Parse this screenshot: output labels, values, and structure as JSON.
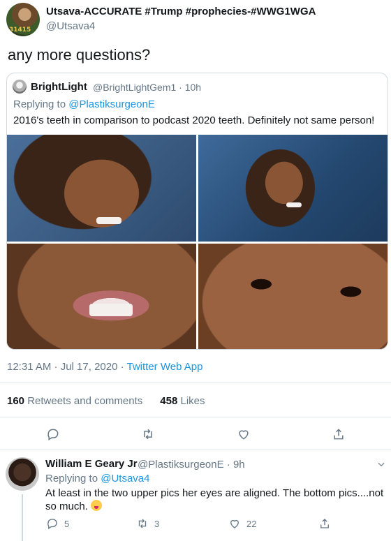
{
  "tweet": {
    "author_name": "Utsava-ACCURATE #Trump #prophecies-#WWG1WGA",
    "author_handle": "@Utsava4",
    "avatar_badge": "31415",
    "text": "any more questions?",
    "timestamp": "12:31 AM · Jul 17, 2020 · ",
    "source_app": "Twitter Web App",
    "retweets_count": "160",
    "retweets_label": " Retweets and comments",
    "likes_count": "458",
    "likes_label": " Likes"
  },
  "quoted_tweet": {
    "author_name": "BrightLight",
    "author_handle": "@BrightLightGem1 · 10h",
    "replying_prefix": "Replying to ",
    "replying_to": "@PlastiksurgeonE",
    "text": "2016's teeth in comparison to podcast 2020 teeth. Definitely not same person!"
  },
  "reply": {
    "author_name": "William E Geary Jr",
    "author_handle": "@PlastiksurgeonE · 9h",
    "replying_prefix": "Replying to ",
    "replying_to": "@Utsava4",
    "text": "At least in the two upper pics her eyes are aligned. The bottom pics....not so much. ",
    "reply_count": "5",
    "retweet_count": "3",
    "like_count": "22"
  },
  "icons": {
    "reply": "reply-icon",
    "retweet": "retweet-icon",
    "like": "heart-icon",
    "share": "share-icon",
    "more": "chevron-down-icon",
    "emoji": "zany-face-emoji"
  },
  "colors": {
    "link": "#1b95e0",
    "secondary_text": "#657786",
    "primary_text": "#14171a",
    "border": "#e1e8ed"
  }
}
